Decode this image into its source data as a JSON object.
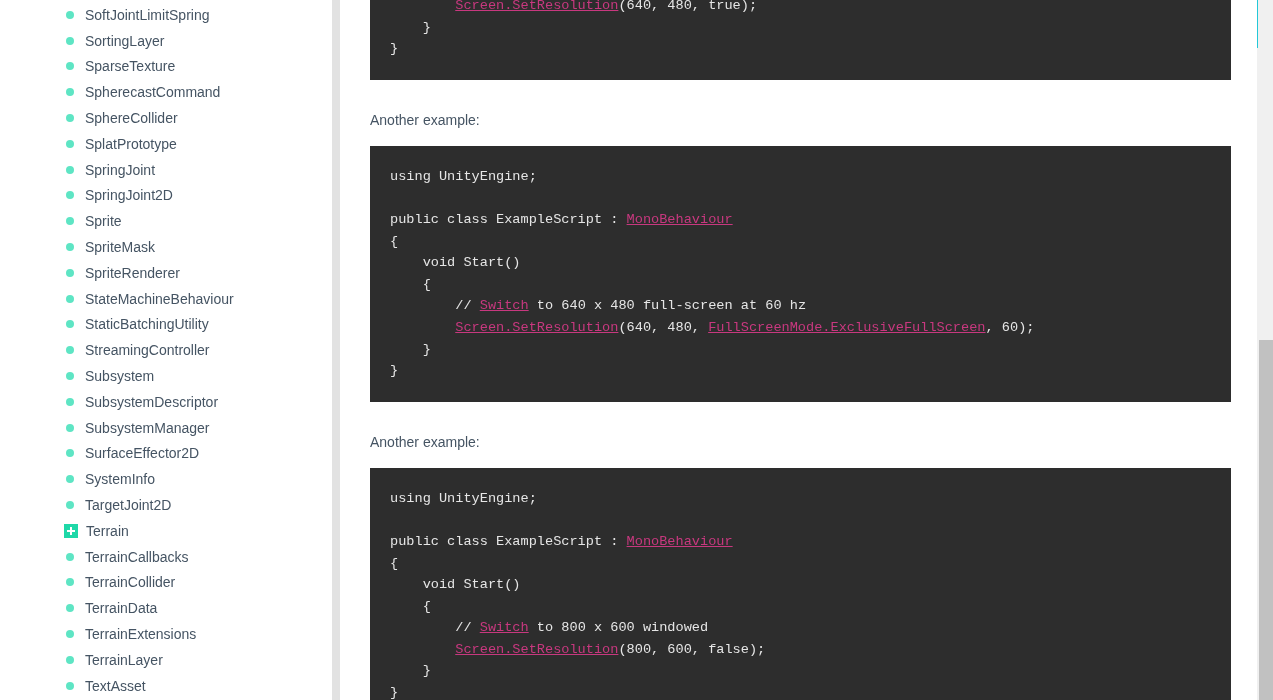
{
  "sidebar": {
    "items": [
      {
        "label": "SoftJointLimitSpring",
        "kind": "page"
      },
      {
        "label": "SortingLayer",
        "kind": "page"
      },
      {
        "label": "SparseTexture",
        "kind": "page"
      },
      {
        "label": "SpherecastCommand",
        "kind": "page"
      },
      {
        "label": "SphereCollider",
        "kind": "page"
      },
      {
        "label": "SplatPrototype",
        "kind": "page"
      },
      {
        "label": "SpringJoint",
        "kind": "page"
      },
      {
        "label": "SpringJoint2D",
        "kind": "page"
      },
      {
        "label": "Sprite",
        "kind": "page"
      },
      {
        "label": "SpriteMask",
        "kind": "page"
      },
      {
        "label": "SpriteRenderer",
        "kind": "page"
      },
      {
        "label": "StateMachineBehaviour",
        "kind": "page"
      },
      {
        "label": "StaticBatchingUtility",
        "kind": "page"
      },
      {
        "label": "StreamingController",
        "kind": "page"
      },
      {
        "label": "Subsystem",
        "kind": "page"
      },
      {
        "label": "SubsystemDescriptor",
        "kind": "page"
      },
      {
        "label": "SubsystemManager",
        "kind": "page"
      },
      {
        "label": "SurfaceEffector2D",
        "kind": "page"
      },
      {
        "label": "SystemInfo",
        "kind": "page"
      },
      {
        "label": "TargetJoint2D",
        "kind": "page"
      },
      {
        "label": "Terrain",
        "kind": "group"
      },
      {
        "label": "TerrainCallbacks",
        "kind": "page"
      },
      {
        "label": "TerrainCollider",
        "kind": "page"
      },
      {
        "label": "TerrainData",
        "kind": "page"
      },
      {
        "label": "TerrainExtensions",
        "kind": "page"
      },
      {
        "label": "TerrainLayer",
        "kind": "page"
      },
      {
        "label": "TextAsset",
        "kind": "page"
      }
    ]
  },
  "content": [
    {
      "kind": "code",
      "lines": [
        {
          "kind": "statement",
          "segments": [
            {
              "kind": "link",
              "text": "Screen.SetResolution"
            },
            {
              "kind": "text",
              "text": "(640, 480, true);"
            }
          ]
        },
        {
          "kind": "method",
          "segments": [
            {
              "kind": "text",
              "text": "}"
            }
          ]
        },
        {
          "kind": "outer",
          "segments": [
            {
              "kind": "text",
              "text": "}"
            }
          ]
        }
      ]
    },
    {
      "kind": "paragraph",
      "text": "Another example:"
    },
    {
      "kind": "code",
      "lines": [
        {
          "kind": "outer",
          "segments": [
            {
              "kind": "text",
              "text": "using UnityEngine;"
            }
          ]
        },
        {
          "kind": "blank"
        },
        {
          "kind": "outer",
          "segments": [
            {
              "kind": "text",
              "text": "public class ExampleScript : "
            },
            {
              "kind": "link",
              "text": "MonoBehaviour"
            }
          ]
        },
        {
          "kind": "outer",
          "segments": [
            {
              "kind": "text",
              "text": "{"
            }
          ]
        },
        {
          "kind": "method",
          "segments": [
            {
              "kind": "text",
              "text": "void Start()"
            }
          ]
        },
        {
          "kind": "method",
          "segments": [
            {
              "kind": "text",
              "text": "{"
            }
          ]
        },
        {
          "kind": "statement",
          "segments": [
            {
              "kind": "text",
              "text": "// "
            },
            {
              "kind": "link",
              "text": "Switch"
            },
            {
              "kind": "text",
              "text": " to 640 x 480 full-screen at 60 hz"
            }
          ]
        },
        {
          "kind": "statement",
          "segments": [
            {
              "kind": "link",
              "text": "Screen.SetResolution"
            },
            {
              "kind": "text",
              "text": "(640, 480, "
            },
            {
              "kind": "link",
              "text": "FullScreenMode.ExclusiveFullScreen"
            },
            {
              "kind": "text",
              "text": ", 60);"
            }
          ]
        },
        {
          "kind": "method",
          "segments": [
            {
              "kind": "text",
              "text": "}"
            }
          ]
        },
        {
          "kind": "outer",
          "segments": [
            {
              "kind": "text",
              "text": "}"
            }
          ]
        }
      ]
    },
    {
      "kind": "paragraph",
      "text": "Another example:"
    },
    {
      "kind": "code",
      "lines": [
        {
          "kind": "outer",
          "segments": [
            {
              "kind": "text",
              "text": "using UnityEngine;"
            }
          ]
        },
        {
          "kind": "blank"
        },
        {
          "kind": "outer",
          "segments": [
            {
              "kind": "text",
              "text": "public class ExampleScript : "
            },
            {
              "kind": "link",
              "text": "MonoBehaviour"
            }
          ]
        },
        {
          "kind": "outer",
          "segments": [
            {
              "kind": "text",
              "text": "{"
            }
          ]
        },
        {
          "kind": "method",
          "segments": [
            {
              "kind": "text",
              "text": "void Start()"
            }
          ]
        },
        {
          "kind": "method",
          "segments": [
            {
              "kind": "text",
              "text": "{"
            }
          ]
        },
        {
          "kind": "statement",
          "segments": [
            {
              "kind": "text",
              "text": "// "
            },
            {
              "kind": "link",
              "text": "Switch"
            },
            {
              "kind": "text",
              "text": " to 800 x 600 windowed"
            }
          ]
        },
        {
          "kind": "statement",
          "segments": [
            {
              "kind": "link",
              "text": "Screen.SetResolution"
            },
            {
              "kind": "text",
              "text": "(800, 600, false);"
            }
          ]
        },
        {
          "kind": "method",
          "segments": [
            {
              "kind": "text",
              "text": "}"
            }
          ]
        },
        {
          "kind": "outer",
          "segments": [
            {
              "kind": "text",
              "text": "}"
            }
          ]
        }
      ]
    }
  ]
}
